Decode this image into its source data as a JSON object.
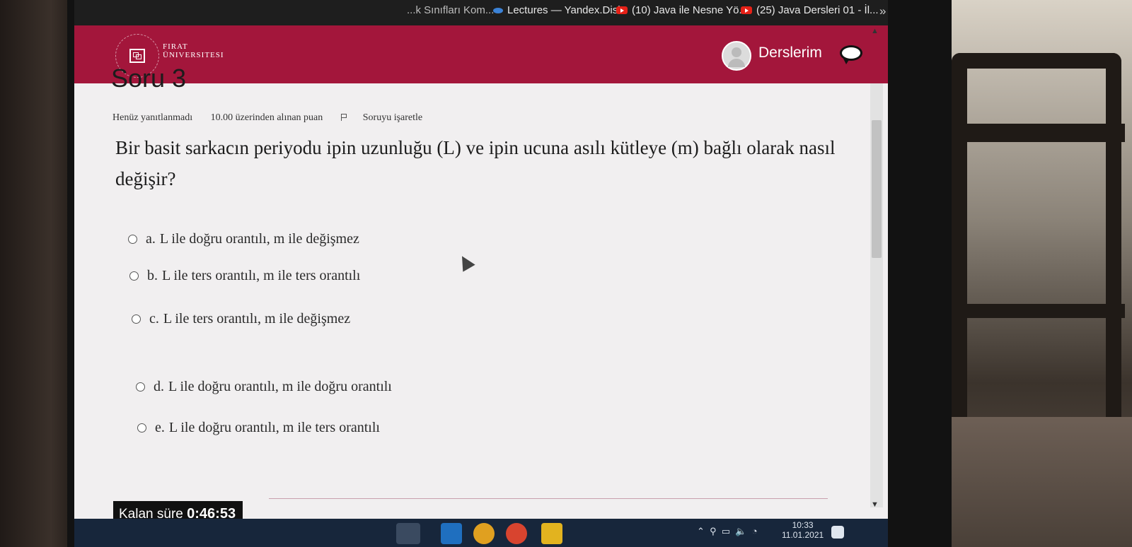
{
  "bookmarks": {
    "item1": "...k Sınıfları Kom...",
    "item2": "Lectures — Yandex.Disk",
    "item3": "(10) Java ile Nesne Yö...",
    "item4": "(25) Java Dersleri 01 - İl...",
    "more": "»"
  },
  "header": {
    "university_line1": "FIRAT",
    "university_line2": "ÜNIVERSITESI",
    "menu_label": "Derslerim"
  },
  "question": {
    "title": "Soru 3",
    "status": "Henüz yanıtlanmadı",
    "points": "10.00 üzerinden alınan puan",
    "flag_label": "Soruyu işaretle",
    "text": "Bir basit sarkacın periyodu ipin uzunluğu (L) ve ipin ucuna asılı kütleye (m) bağlı olarak nasıl değişir?",
    "options": [
      {
        "letter": "a.",
        "text": "L ile doğru orantılı, m ile değişmez"
      },
      {
        "letter": "b.",
        "text": "L ile ters orantılı, m ile ters orantılı"
      },
      {
        "letter": "c.",
        "text": "L ile ters orantılı, m ile değişmez"
      },
      {
        "letter": "d.",
        "text": "L ile doğru orantılı, m ile doğru orantılı"
      },
      {
        "letter": "e.",
        "text": "L ile doğru orantılı, m ile ters orantılı"
      }
    ]
  },
  "timer": {
    "label": "Kalan süre",
    "value": "0:46:53"
  },
  "taskbar": {
    "time": "10:33",
    "date": "11.01.2021"
  },
  "colors": {
    "brand": "#a3163b",
    "taskbar": "#17263b"
  }
}
